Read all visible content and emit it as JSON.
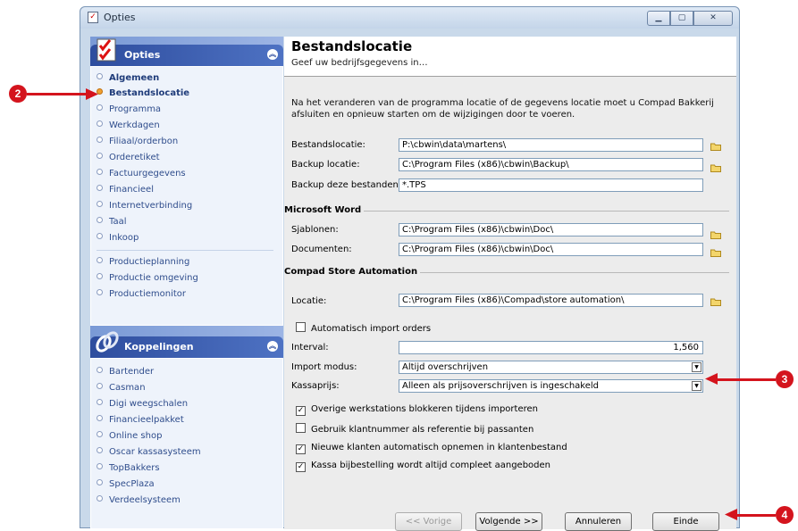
{
  "window": {
    "title": "Opties"
  },
  "sidebar": {
    "opties": {
      "title": "Opties",
      "items": [
        "Algemeen",
        "Bestandslocatie",
        "Programma",
        "Werkdagen",
        "Filiaal/orderbon",
        "Orderetiket",
        "Factuurgegevens",
        "Financieel",
        "Internetverbinding",
        "Taal",
        "Inkoop"
      ],
      "items2": [
        "Productieplanning",
        "Productie omgeving",
        "Productiemonitor"
      ]
    },
    "koppelingen": {
      "title": "Koppelingen",
      "items": [
        "Bartender",
        "Casman",
        "Digi weegschalen",
        "Financieelpakket",
        "Online shop",
        "Oscar kassasysteem",
        "TopBakkers",
        "SpecPlaza",
        "Verdeelsysteem"
      ]
    }
  },
  "main": {
    "title": "Bestandslocatie",
    "subtitle": "Geef uw bedrijfsgegevens in…",
    "intro": "Na het veranderen van de programma locatie of de gegevens locatie moet u Compad Bakkerij afsluiten en opnieuw starten om de wijzigingen door te voeren.",
    "bestandslocatie_label": "Bestandslocatie:",
    "bestandslocatie_value": "P:\\cbwin\\data\\martens\\",
    "backup_label": "Backup locatie:",
    "backup_value": "C:\\Program Files (x86)\\cbwin\\Backup\\",
    "backup_files_label": "Backup deze bestanden:",
    "backup_files_value": "*.TPS",
    "word_section": "Microsoft Word",
    "sjablonen_label": "Sjablonen:",
    "sjablonen_value": "C:\\Program Files (x86)\\cbwin\\Doc\\",
    "documenten_label": "Documenten:",
    "documenten_value": "C:\\Program Files (x86)\\cbwin\\Doc\\",
    "store_section": "Compad Store Automation",
    "locatie_label": "Locatie:",
    "locatie_value": "C:\\Program Files (x86)\\Compad\\store automation\\",
    "auto_import_label": "Automatisch import orders",
    "interval_label": "Interval:",
    "interval_value": "1,560",
    "import_modus_label": "Import modus:",
    "import_modus_value": "Altijd overschrijven",
    "kassaprijs_label": "Kassaprijs:",
    "kassaprijs_value": "Alleen als prijsoverschrijven is ingeschakeld",
    "cb1": "Overige werkstations blokkeren tijdens importeren",
    "cb2": "Gebruik klantnummer als referentie bij passanten",
    "cb3": "Nieuwe klanten automatisch opnemen in klantenbestand",
    "cb4": "Kassa bijbestelling wordt altijd compleet aangeboden"
  },
  "footer": {
    "prev": "<< Vorige",
    "next": "Volgende >>",
    "cancel": "Annuleren",
    "finish": "Einde"
  },
  "annotations": {
    "m2": "2",
    "m3": "3",
    "m4": "4"
  },
  "colors": {
    "accent": "#2e4d9e",
    "marker": "#d4141d"
  }
}
